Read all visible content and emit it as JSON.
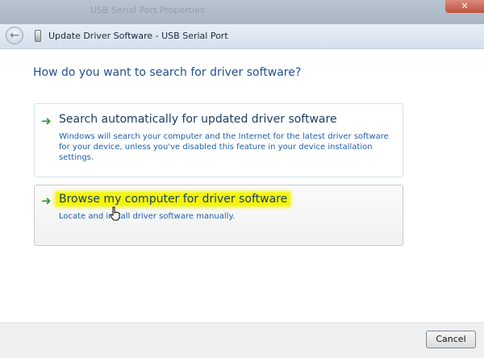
{
  "background_window": {
    "title": "USB Serial Port Properties"
  },
  "window": {
    "title": "Update Driver Software - USB Serial Port"
  },
  "heading": "How do you want to search for driver software?",
  "options": [
    {
      "title": "Search automatically for updated driver software",
      "description": "Windows will search your computer and the Internet for the latest driver software for your device, unless you've disabled this feature in your device installation settings."
    },
    {
      "title": "Browse my computer for driver software",
      "description": "Locate and install driver software manually."
    }
  ],
  "footer": {
    "cancel_label": "Cancel"
  },
  "icons": {
    "arrow": "green-arrow-icon",
    "back": "back-arrow-icon",
    "device": "usb-device-icon",
    "close": "close-icon"
  },
  "colors": {
    "heading": "#1f4f8f",
    "option_desc": "#1e5fae",
    "highlight": "#f5f50a",
    "arrow": "#2d9a2d"
  }
}
